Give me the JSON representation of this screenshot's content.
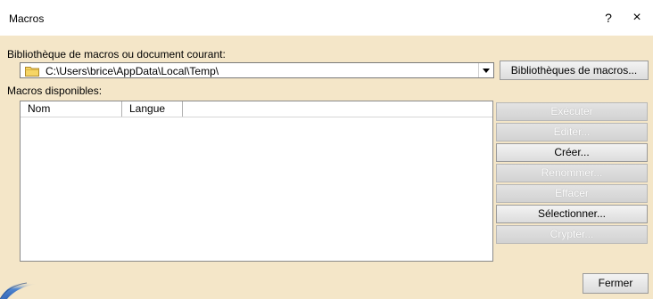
{
  "window": {
    "title": "Macros",
    "help_label": "?",
    "close_label": "×"
  },
  "library": {
    "label": "Bibliothèque de macros ou document courant:",
    "path_value": "C:\\Users\\brice\\AppData\\Local\\Temp\\",
    "libraries_button": "Bibliothèques de macros..."
  },
  "macros": {
    "label": "Macros disponibles:",
    "columns": [
      "Nom",
      "Langue"
    ],
    "rows": []
  },
  "actions": [
    {
      "label": "Exécuter",
      "enabled": false
    },
    {
      "label": "Editer...",
      "enabled": false
    },
    {
      "label": "Créer...",
      "enabled": true
    },
    {
      "label": "Renommer...",
      "enabled": false
    },
    {
      "label": "Effacer",
      "enabled": false
    },
    {
      "label": "Sélectionner...",
      "enabled": true
    },
    {
      "label": "Crypter...",
      "enabled": false
    }
  ],
  "footer": {
    "close_button": "Fermer"
  },
  "colors": {
    "client_bg": "#f4e6c8",
    "disabled_text": "#ffffff"
  },
  "icons": {
    "folder": "folder-icon",
    "dropdown": "chevron-down-icon",
    "logo": "app-logo"
  }
}
